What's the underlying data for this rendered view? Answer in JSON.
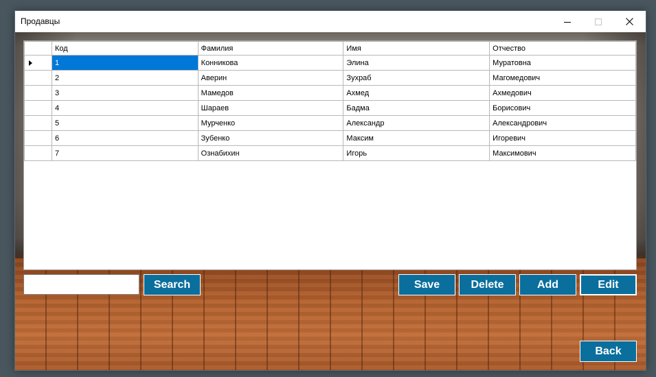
{
  "window": {
    "title": "Продавцы"
  },
  "title_bar_buttons": {
    "minimize_icon": "minimize-icon",
    "maximize_icon": "maximize-icon",
    "close_icon": "close-icon"
  },
  "grid": {
    "columns": [
      "Код",
      "Фамилия",
      "Имя",
      "Отчество"
    ],
    "rows": [
      [
        "1",
        "Конникова",
        "Элина",
        "Муратовна"
      ],
      [
        "2",
        "Аверин",
        "Зухраб",
        "Магомедович"
      ],
      [
        "3",
        "Мамедов",
        "Ахмед",
        "Ахмедович"
      ],
      [
        "4",
        "Шараев",
        "Бадма",
        "Борисович"
      ],
      [
        "5",
        "Мурченко",
        "Александр",
        "Александрович"
      ],
      [
        "6",
        "Зубенко",
        "Максим",
        "Игоревич"
      ],
      [
        "7",
        "Ознабихин",
        "Игорь",
        "Максимович"
      ]
    ],
    "current_row_icon": "row-pointer-icon"
  },
  "search": {
    "value": "",
    "placeholder": "",
    "button_label": "Search"
  },
  "actions": {
    "save_label": "Save",
    "delete_label": "Delete",
    "add_label": "Add",
    "edit_label": "Edit",
    "back_label": "Back"
  },
  "colors": {
    "button_bg": "#0a6f9d",
    "selection": "#0078d7"
  }
}
